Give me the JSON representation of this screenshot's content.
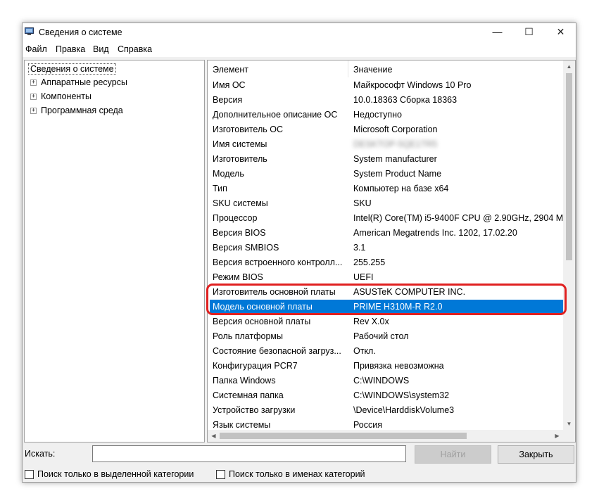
{
  "window": {
    "title": "Сведения о системе",
    "controls": {
      "minimize": "—",
      "maximize": "☐",
      "close": "✕"
    }
  },
  "menu": [
    "Файл",
    "Правка",
    "Вид",
    "Справка"
  ],
  "tree": {
    "root": "Сведения о системе",
    "children": [
      {
        "expander": "+",
        "label": "Аппаратные ресурсы"
      },
      {
        "expander": "+",
        "label": "Компоненты"
      },
      {
        "expander": "+",
        "label": "Программная среда"
      }
    ]
  },
  "table": {
    "headers": {
      "name": "Элемент",
      "value": "Значение"
    },
    "rows": [
      {
        "name": "Имя ОС",
        "value": "Майкрософт Windows 10 Pro"
      },
      {
        "name": "Версия",
        "value": "10.0.18363 Сборка 18363"
      },
      {
        "name": "Дополнительное описание ОС",
        "value": "Недоступно"
      },
      {
        "name": "Изготовитель ОС",
        "value": "Microsoft Corporation"
      },
      {
        "name": "Имя системы",
        "value": "DESKTOP-5QE1TR5"
      },
      {
        "name": "Изготовитель",
        "value": "System manufacturer"
      },
      {
        "name": "Модель",
        "value": "System Product Name"
      },
      {
        "name": "Тип",
        "value": "Компьютер на базе x64"
      },
      {
        "name": "SKU системы",
        "value": "SKU"
      },
      {
        "name": "Процессор",
        "value": "Intel(R) Core(TM) i5-9400F CPU @ 2.90GHz, 2904 M"
      },
      {
        "name": "Версия BIOS",
        "value": "American Megatrends Inc. 1202, 17.02.20"
      },
      {
        "name": "Версия SMBIOS",
        "value": "3.1"
      },
      {
        "name": "Версия встроенного контролл...",
        "value": "255.255"
      },
      {
        "name": "Режим BIOS",
        "value": "UEFI"
      },
      {
        "name": "Изготовитель основной платы",
        "value": "ASUSTeK COMPUTER INC."
      },
      {
        "name": "Модель основной платы",
        "value": "PRIME H310M-R R2.0"
      },
      {
        "name": "Версия основной платы",
        "value": "Rev X.0x"
      },
      {
        "name": "Роль платформы",
        "value": "Рабочий стол"
      },
      {
        "name": "Состояние безопасной загруз...",
        "value": "Откл."
      },
      {
        "name": "Конфигурация PCR7",
        "value": "Привязка невозможна"
      },
      {
        "name": "Папка Windows",
        "value": "C:\\WINDOWS"
      },
      {
        "name": "Системная папка",
        "value": "C:\\WINDOWS\\system32"
      },
      {
        "name": "Устройство загрузки",
        "value": "\\Device\\HarddiskVolume3"
      },
      {
        "name": "Язык системы",
        "value": "Россия"
      }
    ]
  },
  "search": {
    "label": "Искать:",
    "value": "",
    "find_button": "Найти",
    "close_button": "Закрыть",
    "checkbox_selected_category": "Поиск только в выделенной категории",
    "checkbox_category_names": "Поиск только в именах категорий"
  },
  "colors": {
    "selection": "#0078d7",
    "highlight_outline": "#e02020"
  }
}
